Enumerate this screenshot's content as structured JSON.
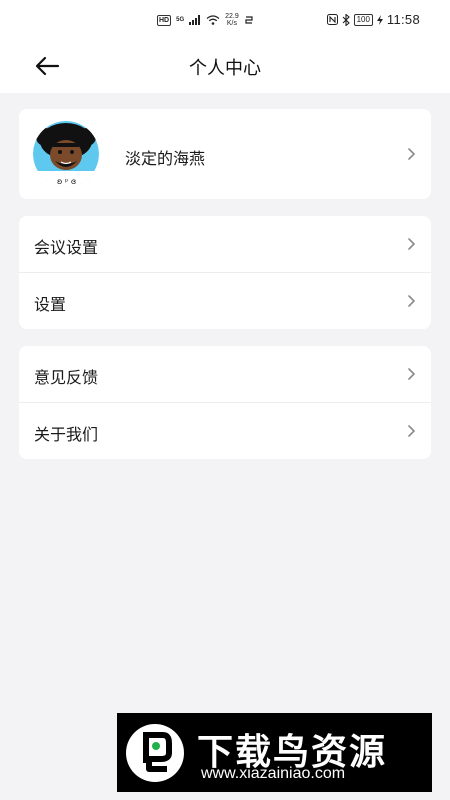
{
  "status_bar": {
    "hd_label": "HD",
    "net_label": "5G",
    "speed_value": "22.9",
    "speed_unit": "K/s",
    "battery_level": "100",
    "time": "11:58"
  },
  "header": {
    "title": "个人中心"
  },
  "profile": {
    "username": "淡定的海燕"
  },
  "menu_group_1": [
    {
      "label": "会议设置"
    },
    {
      "label": "设置"
    }
  ],
  "menu_group_2": [
    {
      "label": "意见反馈"
    },
    {
      "label": "关于我们"
    }
  ],
  "watermark": {
    "title": "下载鸟资源",
    "url": "www.xiazainiao.com"
  },
  "colors": {
    "background": "#f3f3f6",
    "card": "#ffffff",
    "chevron": "#8a8a8e",
    "avatar_ring": "#5fc8ee"
  }
}
